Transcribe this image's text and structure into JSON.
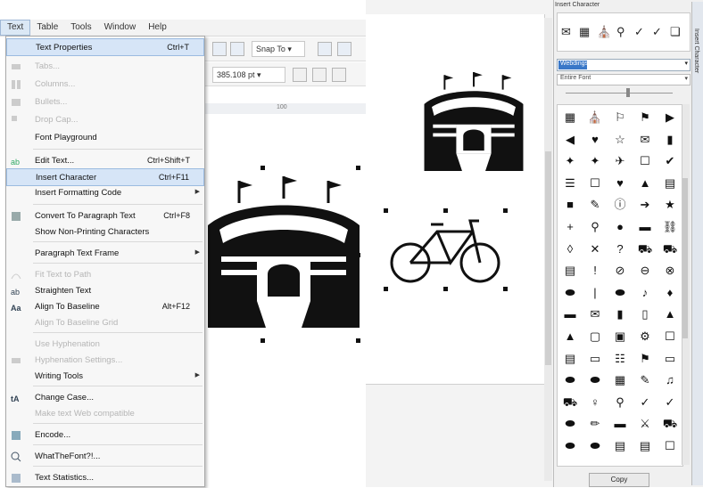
{
  "menubar": {
    "items": [
      "Text",
      "Table",
      "Tools",
      "Window",
      "Help"
    ]
  },
  "toolbar": {
    "snap_label": "Snap To"
  },
  "propbar": {
    "size_value": "385.108 pt"
  },
  "ruler": {
    "marks": [
      "100"
    ]
  },
  "text_menu": {
    "items": [
      {
        "label": "Text Properties",
        "shortcut": "Ctrl+T",
        "disabled": false,
        "highlight": true
      },
      {
        "label": "Tabs...",
        "shortcut": "",
        "disabled": true
      },
      {
        "label": "Columns...",
        "shortcut": "",
        "disabled": true
      },
      {
        "label": "Bullets...",
        "shortcut": "",
        "disabled": true
      },
      {
        "label": "Drop Cap...",
        "shortcut": "",
        "disabled": true
      },
      {
        "label": "Font Playground",
        "shortcut": "",
        "disabled": false
      },
      {
        "label": "Edit Text...",
        "shortcut": "Ctrl+Shift+T",
        "disabled": false
      },
      {
        "label": "Insert Character",
        "shortcut": "Ctrl+F11",
        "disabled": false,
        "highlight": true
      },
      {
        "label": "Insert Formatting Code",
        "shortcut": "",
        "disabled": false,
        "submenu": true
      },
      {
        "label": "Convert To Paragraph Text",
        "shortcut": "Ctrl+F8",
        "disabled": false
      },
      {
        "label": "Show Non-Printing Characters",
        "shortcut": "",
        "disabled": false
      },
      {
        "label": "Paragraph Text Frame",
        "shortcut": "",
        "disabled": false,
        "submenu": true
      },
      {
        "label": "Fit Text to Path",
        "shortcut": "",
        "disabled": true
      },
      {
        "label": "Straighten Text",
        "shortcut": "",
        "disabled": false
      },
      {
        "label": "Align To Baseline",
        "shortcut": "Alt+F12",
        "disabled": false
      },
      {
        "label": "Align To Baseline Grid",
        "shortcut": "",
        "disabled": true
      },
      {
        "label": "Use Hyphenation",
        "shortcut": "",
        "disabled": true
      },
      {
        "label": "Hyphenation Settings...",
        "shortcut": "",
        "disabled": true
      },
      {
        "label": "Writing Tools",
        "shortcut": "",
        "disabled": false,
        "submenu": true
      },
      {
        "label": "Change Case...",
        "shortcut": "",
        "disabled": false
      },
      {
        "label": "Make text Web compatible",
        "shortcut": "",
        "disabled": true
      },
      {
        "label": "Encode...",
        "shortcut": "",
        "disabled": false
      },
      {
        "label": "WhatTheFont?!...",
        "shortcut": "",
        "disabled": false
      },
      {
        "label": "Text Statistics...",
        "shortcut": "",
        "disabled": false
      }
    ]
  },
  "docker": {
    "title": "Insert Character",
    "tab_label": "Insert Character",
    "recent_glyphs": [
      "✉",
      "▦",
      "⛪",
      "⚲",
      "✓",
      "✓",
      "❏"
    ],
    "font_value": "Webdings",
    "subset_value": "Entire Font",
    "copy_label": "Copy",
    "glyphs": [
      "▦",
      "⛪",
      "⚐",
      "⚑",
      "▶",
      "◀",
      "♥",
      "☆",
      "✉",
      "▮",
      "✦",
      "✦",
      "✈",
      "☐",
      "✔",
      "☰",
      "☐",
      "♥",
      "▲",
      "▤",
      "■",
      "✎",
      "ⓘ",
      "➔",
      "★",
      "+",
      "⚲",
      "●",
      "▬",
      "⛓",
      "◊",
      "✕",
      "?",
      "⛟",
      "⛟",
      "▤",
      "!",
      "⊘",
      "⊖",
      "⊗",
      "⬬",
      "|",
      "⬬",
      "♪",
      "♦",
      "▬",
      "✉",
      "▮",
      "▯",
      "▲",
      "▲",
      "▢",
      "▣",
      "⚙",
      "☐",
      "▤",
      "▭",
      "☷",
      "⚑",
      "▭",
      "⬬",
      "⬬",
      "▦",
      "✎",
      "♫",
      "⛟",
      "♀",
      "⚲",
      "✓",
      "✓",
      "⬬",
      "✏",
      "▬",
      "⚔",
      "⛟",
      "⬬",
      "⬬",
      "▤",
      "▤",
      "☐"
    ]
  },
  "colors": {
    "highlight_bg": "#d6e5f7",
    "font_selection": "#3a78c8",
    "icon_black": "#111111"
  }
}
